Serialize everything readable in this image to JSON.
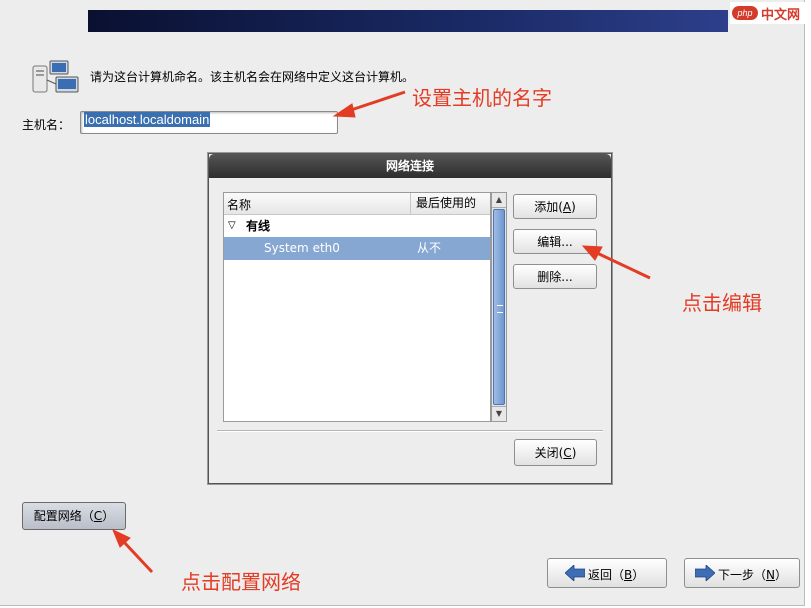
{
  "watermark": {
    "badge": "php",
    "text": "中文网"
  },
  "intro_text": "请为这台计算机命名。该主机名会在网络中定义这台计算机。",
  "hostname": {
    "label": "主机名：",
    "value": "localhost.localdomain"
  },
  "annotations": {
    "hostname_tip": "设置主机的名字",
    "edit_tip": "点击编辑",
    "config_tip": "点击配置网络"
  },
  "dialog": {
    "title": "网络连接",
    "columns": [
      "名称",
      "最后使用的"
    ],
    "group": "有线",
    "rows": [
      {
        "name": "System eth0",
        "last_used": "从不"
      }
    ],
    "buttons": {
      "add": {
        "text": "添加(",
        "key": "A",
        "end": ")"
      },
      "edit": "编辑...",
      "delete": "删除...",
      "close": {
        "text": "关闭(",
        "key": "C",
        "end": ")"
      }
    }
  },
  "config_button": {
    "text": "配置网络（",
    "key": "C",
    "end": "）"
  },
  "nav": {
    "back": {
      "text": "返回（",
      "key": "B",
      "end": "）"
    },
    "next": {
      "text": "下一步（",
      "key": "N",
      "end": "）"
    }
  },
  "colors": {
    "annotation": "#e33c25",
    "selection": "#86a7d2",
    "banner": "#1a2a66"
  }
}
